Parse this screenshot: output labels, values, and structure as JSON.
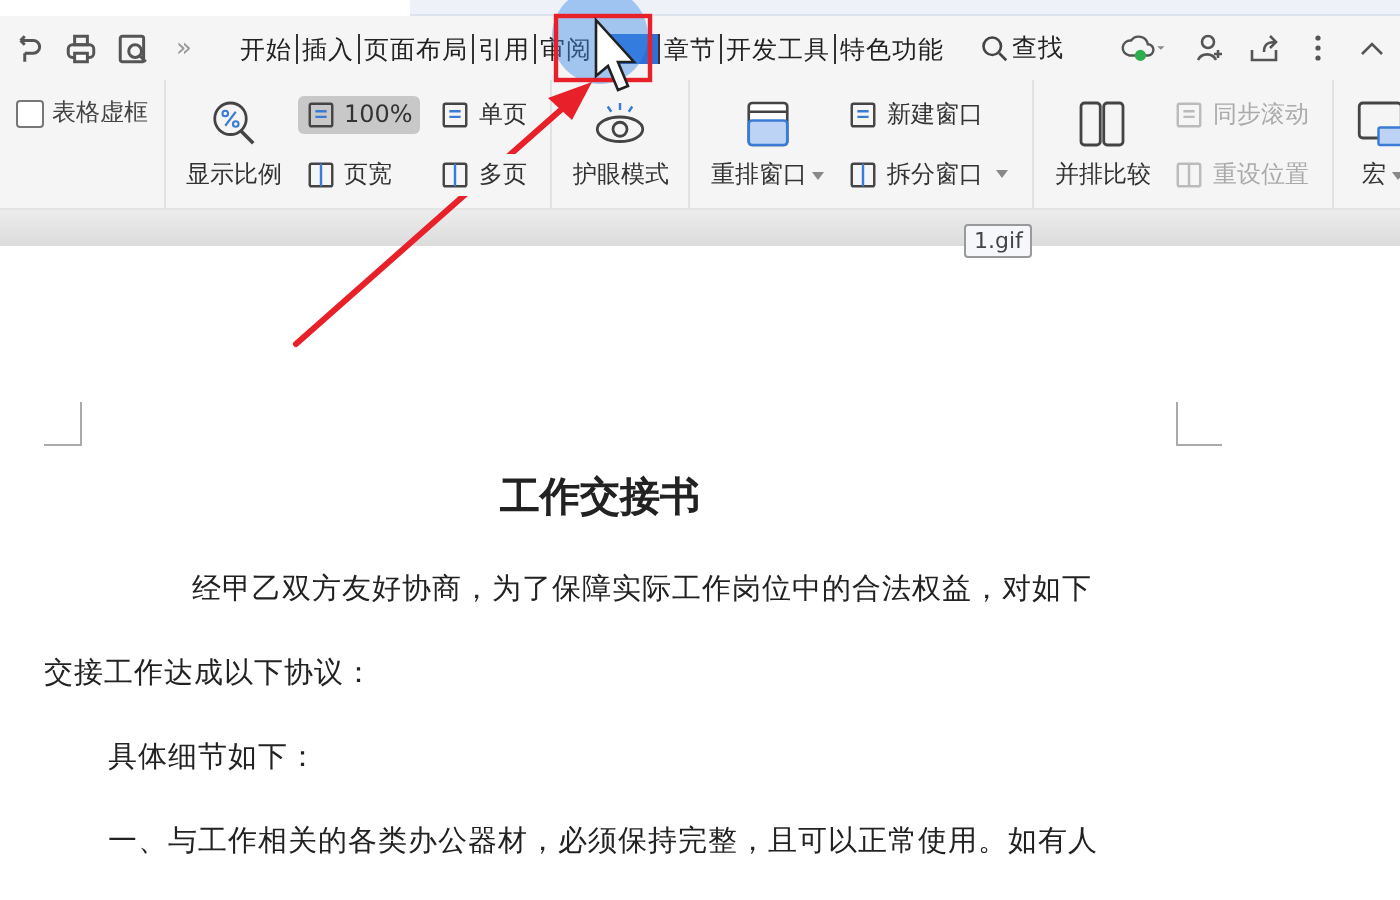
{
  "tabs": [
    {
      "label": "开始",
      "selected": false
    },
    {
      "label": "插入",
      "selected": false
    },
    {
      "label": "页面布局",
      "selected": false
    },
    {
      "label": "引用",
      "selected": false
    },
    {
      "label": "审阅",
      "selected": false
    },
    {
      "selected": true
    },
    {
      "label": "章节",
      "selected": false
    },
    {
      "label": "开发工具",
      "selected": false
    },
    {
      "label": "特色功能",
      "selected": false
    }
  ],
  "overflow": "»",
  "search": {
    "label": "查找"
  },
  "ribbon": [
    {
      "items": [
        {
          "kind": "checkbox",
          "label": "表格虚框",
          "checked": false
        }
      ]
    },
    {
      "items": [
        {
          "kind": "large",
          "label": "显示比例",
          "dropdown": false
        },
        {
          "kind": "small",
          "label": "100%",
          "pressed": true
        },
        {
          "kind": "small",
          "label": "页宽",
          "pressed": false
        },
        {
          "kind": "small",
          "label": "单页",
          "pressed": false
        },
        {
          "kind": "small",
          "label": "多页",
          "pressed": false
        }
      ]
    },
    {
      "items": [
        {
          "kind": "large",
          "label": "护眼模式",
          "dropdown": false
        }
      ]
    },
    {
      "items": [
        {
          "kind": "large",
          "label": "重排窗口",
          "dropdown": true
        },
        {
          "kind": "small",
          "label": "新建窗口",
          "dropdown": false,
          "disabled": false
        },
        {
          "kind": "small",
          "label": "拆分窗口",
          "dropdown": true,
          "disabled": false
        }
      ]
    },
    {
      "items": [
        {
          "kind": "large",
          "label": "并排比较",
          "dropdown": false
        },
        {
          "kind": "small",
          "label": "同步滚动",
          "disabled": true
        },
        {
          "kind": "small",
          "label": "重设位置",
          "disabled": true
        }
      ]
    },
    {
      "items": [
        {
          "kind": "large",
          "label": "宏",
          "dropdown": true
        }
      ]
    }
  ],
  "tooltip": "1.gif",
  "document": {
    "title": "工作交接书",
    "paragraphs": [
      {
        "kind": "lead",
        "text": "经甲乙双方友好协商，为了保障实际工作岗位中的合法权益，对如下"
      },
      {
        "kind": "plain",
        "text": "交接工作达成以下协议："
      },
      {
        "kind": "item",
        "text": "具体细节如下："
      },
      {
        "kind": "item",
        "text": "一、与工作相关的各类办公器材，必须保持完整，且可以正常使用。如有人"
      }
    ]
  }
}
